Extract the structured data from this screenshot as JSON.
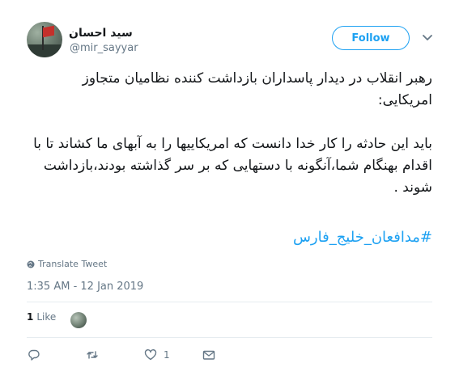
{
  "user": {
    "display_name": "سید احسان",
    "handle": "@mir_sayyar"
  },
  "follow_label": "Follow",
  "tweet": {
    "line1": "رهبر انقلاب در دیدار پاسداران بازداشت کننده نظامیان متجاوز امریکایی:",
    "line2": "باید این حادثه را کار خدا دانست که امریکاییها را به آبهای ما کشاند تا با اقدام بهنگام شما،آنگونه با دستهایی که بر سر گذاشته بودند،بازداشت شوند .",
    "hashtag": "#مدافعان_خلیج_فارس"
  },
  "translate_label": "Translate Tweet",
  "timestamp": "1:35 AM - 12 Jan 2019",
  "likes": {
    "count": "1",
    "label": "Like"
  },
  "actions": {
    "reply": "",
    "retweet": "",
    "like_count": "1"
  },
  "icons": {
    "caret": "chevron-down-icon",
    "globe": "globe-icon",
    "reply": "reply-icon",
    "retweet": "retweet-icon",
    "like": "heart-icon",
    "dm": "envelope-icon"
  },
  "colors": {
    "accent": "#1da1f2",
    "text": "#14171a",
    "muted": "#657786",
    "divider": "#e6ecf0"
  }
}
